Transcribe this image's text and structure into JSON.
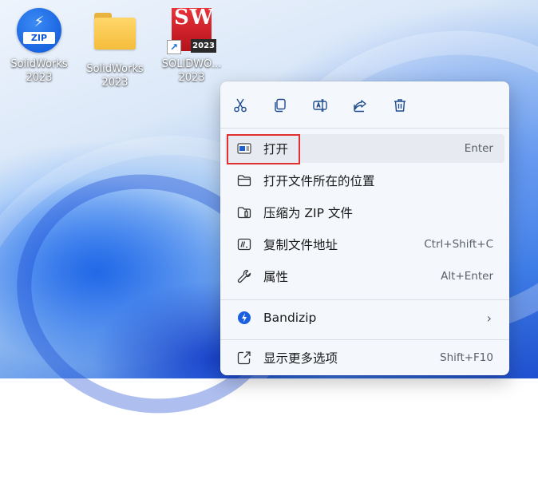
{
  "desktop": {
    "icons": [
      {
        "name": "SolidWorks",
        "line2": "2023",
        "type": "bandizip-archive",
        "badge": "ZIP"
      },
      {
        "name": "SolidWorks",
        "line2": "2023",
        "type": "folder"
      },
      {
        "name": "SOLIDWO...",
        "line2": "2023",
        "type": "solidworks-shortcut",
        "logo": "SW",
        "version": "2023"
      }
    ]
  },
  "context_menu": {
    "toolbar": [
      {
        "icon": "cut-icon"
      },
      {
        "icon": "copy-icon"
      },
      {
        "icon": "rename-icon"
      },
      {
        "icon": "share-icon"
      },
      {
        "icon": "delete-icon"
      }
    ],
    "items": [
      {
        "icon": "open-window-icon",
        "label": "打开",
        "shortcut": "Enter",
        "highlighted": true
      },
      {
        "icon": "folder-outline-icon",
        "label": "打开文件所在的位置",
        "shortcut": ""
      },
      {
        "icon": "zip-folder-icon",
        "label": "压缩为 ZIP 文件",
        "shortcut": ""
      },
      {
        "icon": "copy-path-icon",
        "label": "复制文件地址",
        "shortcut": "Ctrl+Shift+C"
      },
      {
        "icon": "wrench-icon",
        "label": "属性",
        "shortcut": "Alt+Enter"
      },
      {
        "icon": "bandizip-icon",
        "label": "Bandizip",
        "has_submenu": true
      },
      {
        "icon": "show-more-icon",
        "label": "显示更多选项",
        "shortcut": "Shift+F10"
      }
    ],
    "highlight_color": "#e03030"
  }
}
